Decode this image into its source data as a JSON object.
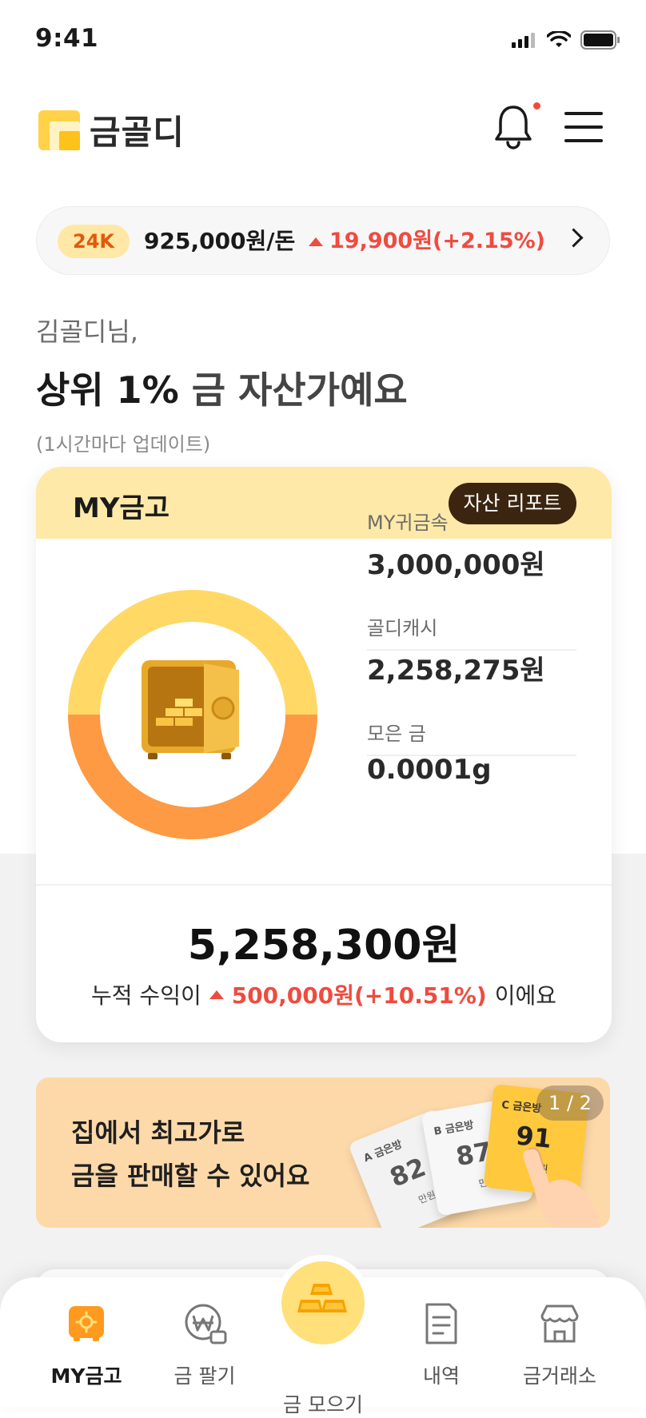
{
  "status_bar": {
    "time": "9:41"
  },
  "header": {
    "app_name": "금골디"
  },
  "ticker": {
    "badge": "24K",
    "price": "925,000원/돈",
    "change": "19,900원(+2.15%)"
  },
  "greeting": {
    "name": "김골디님,",
    "headline_strong": "상위 1%",
    "headline_rest": " 금 자산가예요",
    "note": "(1시간마다 업데이트)"
  },
  "vault": {
    "title": "MY금고",
    "report_button": "자산 리포트",
    "stats": [
      {
        "label": "MY귀금속",
        "value": "3,000,000원"
      },
      {
        "label": "골디캐시",
        "value": "2,258,275원"
      },
      {
        "label": "모은 금",
        "value": "0.0001g"
      }
    ],
    "total": "5,258,300원",
    "profit_prefix": "누적 수익이",
    "profit_amount": "500,000원(+10.51%)",
    "profit_suffix": "이에요",
    "colors": {
      "top": "#ffd866",
      "bottom": "#fd9a43"
    }
  },
  "banner": {
    "line1": "집에서 최고가로",
    "line2": "금을 판매할 수 있어요",
    "pager": "1 / 2",
    "offers": [
      {
        "label": "A 금은방",
        "value": "82",
        "unit": "만원"
      },
      {
        "label": "B 금은방",
        "value": "87",
        "unit": "만원"
      },
      {
        "label": "C 금은방",
        "value": "91",
        "unit": "만원"
      }
    ]
  },
  "nav": {
    "items": [
      {
        "label": "MY금고",
        "icon": "vault-icon"
      },
      {
        "label": "금 팔기",
        "icon": "sell-won-icon"
      },
      {
        "label": "금 모으기",
        "icon": "gold-bars-icon"
      },
      {
        "label": "내역",
        "icon": "history-doc-icon"
      },
      {
        "label": "금거래소",
        "icon": "store-icon"
      }
    ]
  }
}
